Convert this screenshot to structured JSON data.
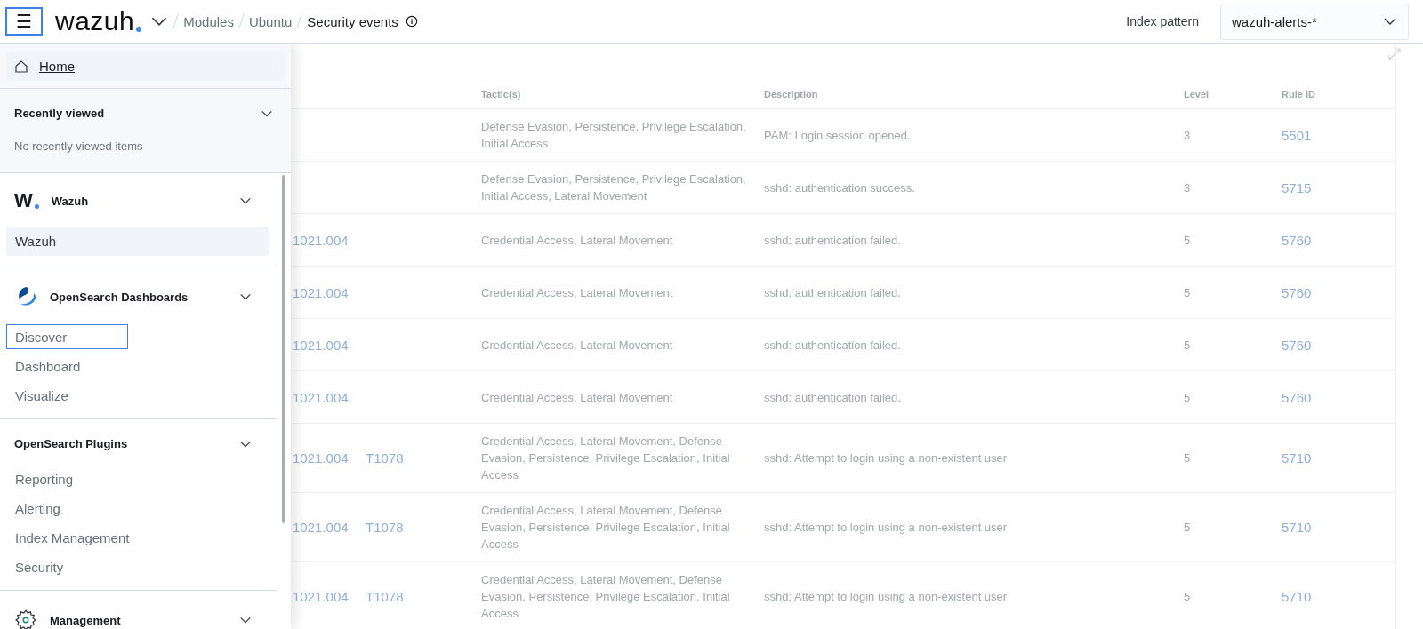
{
  "header": {
    "menu_button": "☰",
    "logo": "wazuh",
    "breadcrumbs": [
      {
        "label": "Modules",
        "current": false
      },
      {
        "label": "Ubuntu",
        "current": false
      },
      {
        "label": "Security events",
        "current": true
      }
    ],
    "index_pattern": {
      "label": "Index pattern",
      "value": "wazuh-alerts-*"
    }
  },
  "nav": {
    "home": {
      "label": "Home",
      "selected": true
    },
    "recently_viewed": {
      "title": "Recently viewed",
      "expanded": true,
      "empty_text": "No recently viewed items"
    },
    "groups": [
      {
        "title": "Wazuh",
        "kind": "wazuh",
        "logo_text": "W",
        "expanded": true,
        "items": [
          {
            "label": "Wazuh",
            "selected": true,
            "focused": false
          }
        ]
      },
      {
        "title": "OpenSearch Dashboards",
        "kind": "opensearch",
        "expanded": true,
        "items": [
          {
            "label": "Discover",
            "selected": false,
            "focused": true
          },
          {
            "label": "Dashboard",
            "selected": false,
            "focused": false
          },
          {
            "label": "Visualize",
            "selected": false,
            "focused": false
          }
        ]
      },
      {
        "title": "OpenSearch Plugins",
        "kind": "plain",
        "expanded": true,
        "items": [
          {
            "label": "Reporting",
            "selected": false,
            "focused": false
          },
          {
            "label": "Alerting",
            "selected": false,
            "focused": false
          },
          {
            "label": "Index Management",
            "selected": false,
            "focused": false
          },
          {
            "label": "Security",
            "selected": false,
            "focused": false
          }
        ]
      },
      {
        "title": "Management",
        "kind": "gear",
        "expanded": true
      }
    ]
  },
  "table": {
    "columns": [
      "",
      "",
      "Tactic(s)",
      "Description",
      "Level",
      "Rule ID"
    ],
    "rows": [
      {
        "tactics": "Defense Evasion, Persistence, Privilege Escalation, Initial Access",
        "description": "PAM: Login session opened.",
        "level": "3",
        "rule_id": "5501"
      },
      {
        "tactics": "Defense Evasion, Persistence, Privilege Escalation, Initial Access, Lateral Movement",
        "description": "sshd: authentication success.",
        "level": "3",
        "rule_id": "5715"
      },
      {
        "technique_1": "1021.004",
        "tactics": "Credential Access, Lateral Movement",
        "description": "sshd: authentication failed.",
        "level": "5",
        "rule_id": "5760"
      },
      {
        "technique_1": "1021.004",
        "tactics": "Credential Access, Lateral Movement",
        "description": "sshd: authentication failed.",
        "level": "5",
        "rule_id": "5760"
      },
      {
        "technique_1": "1021.004",
        "tactics": "Credential Access, Lateral Movement",
        "description": "sshd: authentication failed.",
        "level": "5",
        "rule_id": "5760"
      },
      {
        "technique_1": "1021.004",
        "tactics": "Credential Access, Lateral Movement",
        "description": "sshd: authentication failed.",
        "level": "5",
        "rule_id": "5760"
      },
      {
        "technique_1": "1021.004",
        "technique_2": "T1078",
        "tactics": "Credential Access, Lateral Movement, Defense Evasion, Persistence, Privilege Escalation, Initial Access",
        "description": "sshd: Attempt to login using a non-existent user",
        "level": "5",
        "rule_id": "5710"
      },
      {
        "technique_1": "1021.004",
        "technique_2": "T1078",
        "tactics": "Credential Access, Lateral Movement, Defense Evasion, Persistence, Privilege Escalation, Initial Access",
        "description": "sshd: Attempt to login using a non-existent user",
        "level": "5",
        "rule_id": "5710"
      },
      {
        "technique_1": "1021.004",
        "technique_2": "T1078",
        "tactics": "Credential Access, Lateral Movement, Defense Evasion, Persistence, Privilege Escalation, Initial Access",
        "description": "sshd: Attempt to login using a non-existent user",
        "level": "5",
        "rule_id": "5710"
      }
    ]
  }
}
